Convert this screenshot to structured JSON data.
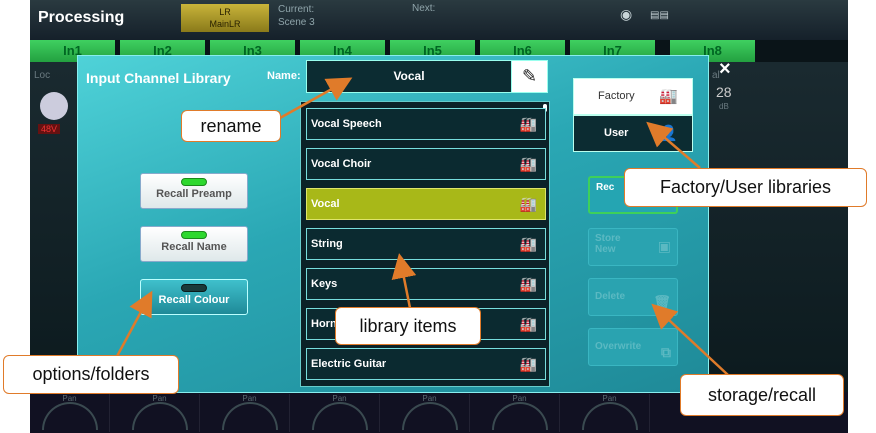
{
  "topbar": {
    "title": "Processing",
    "lr_tag_line1": "LR",
    "lr_tag_line2": "MainLR",
    "current_label": "Current:",
    "current_value": "Scene 3",
    "next_label": "Next:"
  },
  "channels": [
    "In1",
    "In2",
    "In3",
    "In4",
    "In5",
    "In6",
    "In7",
    "In8"
  ],
  "side": {
    "loc": "Loc",
    "al": "al",
    "db_value": "28",
    "db_unit": "dB",
    "v48": "48V"
  },
  "pans": [
    "Pan",
    "Pan",
    "Pan",
    "Pan",
    "Pan",
    "Pan",
    "Pan",
    "Pan",
    "Pan"
  ],
  "modal": {
    "title": "Input Channel Library",
    "name_label": "Name:",
    "name_value": "Vocal",
    "close": "×"
  },
  "options": [
    {
      "label": "Recall Preamp",
      "on": true
    },
    {
      "label": "Recall Name",
      "on": true
    },
    {
      "label": "Recall Colour",
      "on": false
    }
  ],
  "library_items": [
    {
      "label": "Vocal Speech",
      "selected": false
    },
    {
      "label": "Vocal Choir",
      "selected": false
    },
    {
      "label": "Vocal",
      "selected": true
    },
    {
      "label": "String",
      "selected": false
    },
    {
      "label": "Keys",
      "selected": false
    },
    {
      "label": "Horn",
      "selected": false
    },
    {
      "label": "Electric Guitar",
      "selected": false
    }
  ],
  "libraries": {
    "factory": "Factory",
    "user": "User"
  },
  "actions": {
    "recall": "Rec",
    "store_new_1": "Store",
    "store_new_2": "New",
    "delete": "Delete",
    "overwrite": "Overwrite"
  },
  "callouts": {
    "rename": "rename",
    "factory_user": "Factory/User libraries",
    "library_items": "library items",
    "options_folders": "options/folders",
    "storage_recall": "storage/recall"
  },
  "colors": {
    "callout_border": "#e07b2a",
    "selected_item": "#a8b818",
    "modal_bg": "#2aa7b4"
  }
}
